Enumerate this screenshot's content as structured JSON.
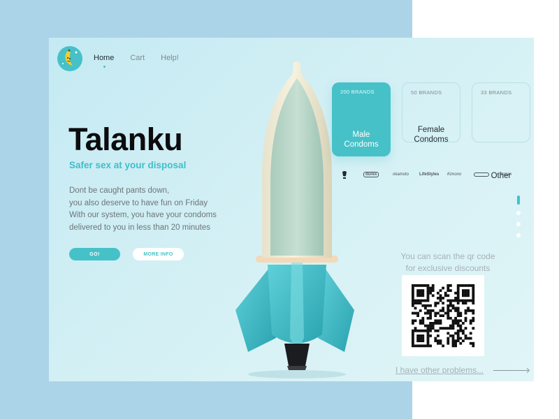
{
  "nav": {
    "items": [
      {
        "label": "Home",
        "active": true
      },
      {
        "label": "Cart",
        "active": false
      },
      {
        "label": "Help!",
        "active": false
      }
    ]
  },
  "hero": {
    "title": "Talanku",
    "tagline": "Safer sex at your disposal",
    "description": [
      "Dont be caught pants down,",
      "you also deserve to have fun on Friday",
      "With our system, you have your condoms",
      "delivered to you in less than 20 minutes"
    ],
    "go_label": "GO!",
    "more_info_label": "MORE INFO"
  },
  "categories": [
    {
      "count": "200 BRANDS",
      "label_line1": "Male",
      "label_line2": "Condoms",
      "selected": true
    },
    {
      "count": "50 BRANDS",
      "label_line1": "Female",
      "label_line2": "Condoms",
      "selected": false
    },
    {
      "count": "33 BRANDS",
      "label_line1": "Other",
      "label_line2": "",
      "selected": false
    }
  ],
  "brand_logos": [
    "durex",
    "okamoto",
    "LifeStyles",
    "Kimono",
    "trojan"
  ],
  "carousel": {
    "count": 4,
    "active_index": 0
  },
  "qr": {
    "text_line1": "You can scan the qr code",
    "text_line2": "for exclusive discounts"
  },
  "other_problems_link": "I have other problems...",
  "colors": {
    "accent": "#46c1c8",
    "page_background": "#acd4e8",
    "card_background": "#d2eff5",
    "title": "#0c0c0e"
  },
  "icons": {
    "logo": "banana-logo-icon",
    "arrow": "arrow-right-icon"
  }
}
